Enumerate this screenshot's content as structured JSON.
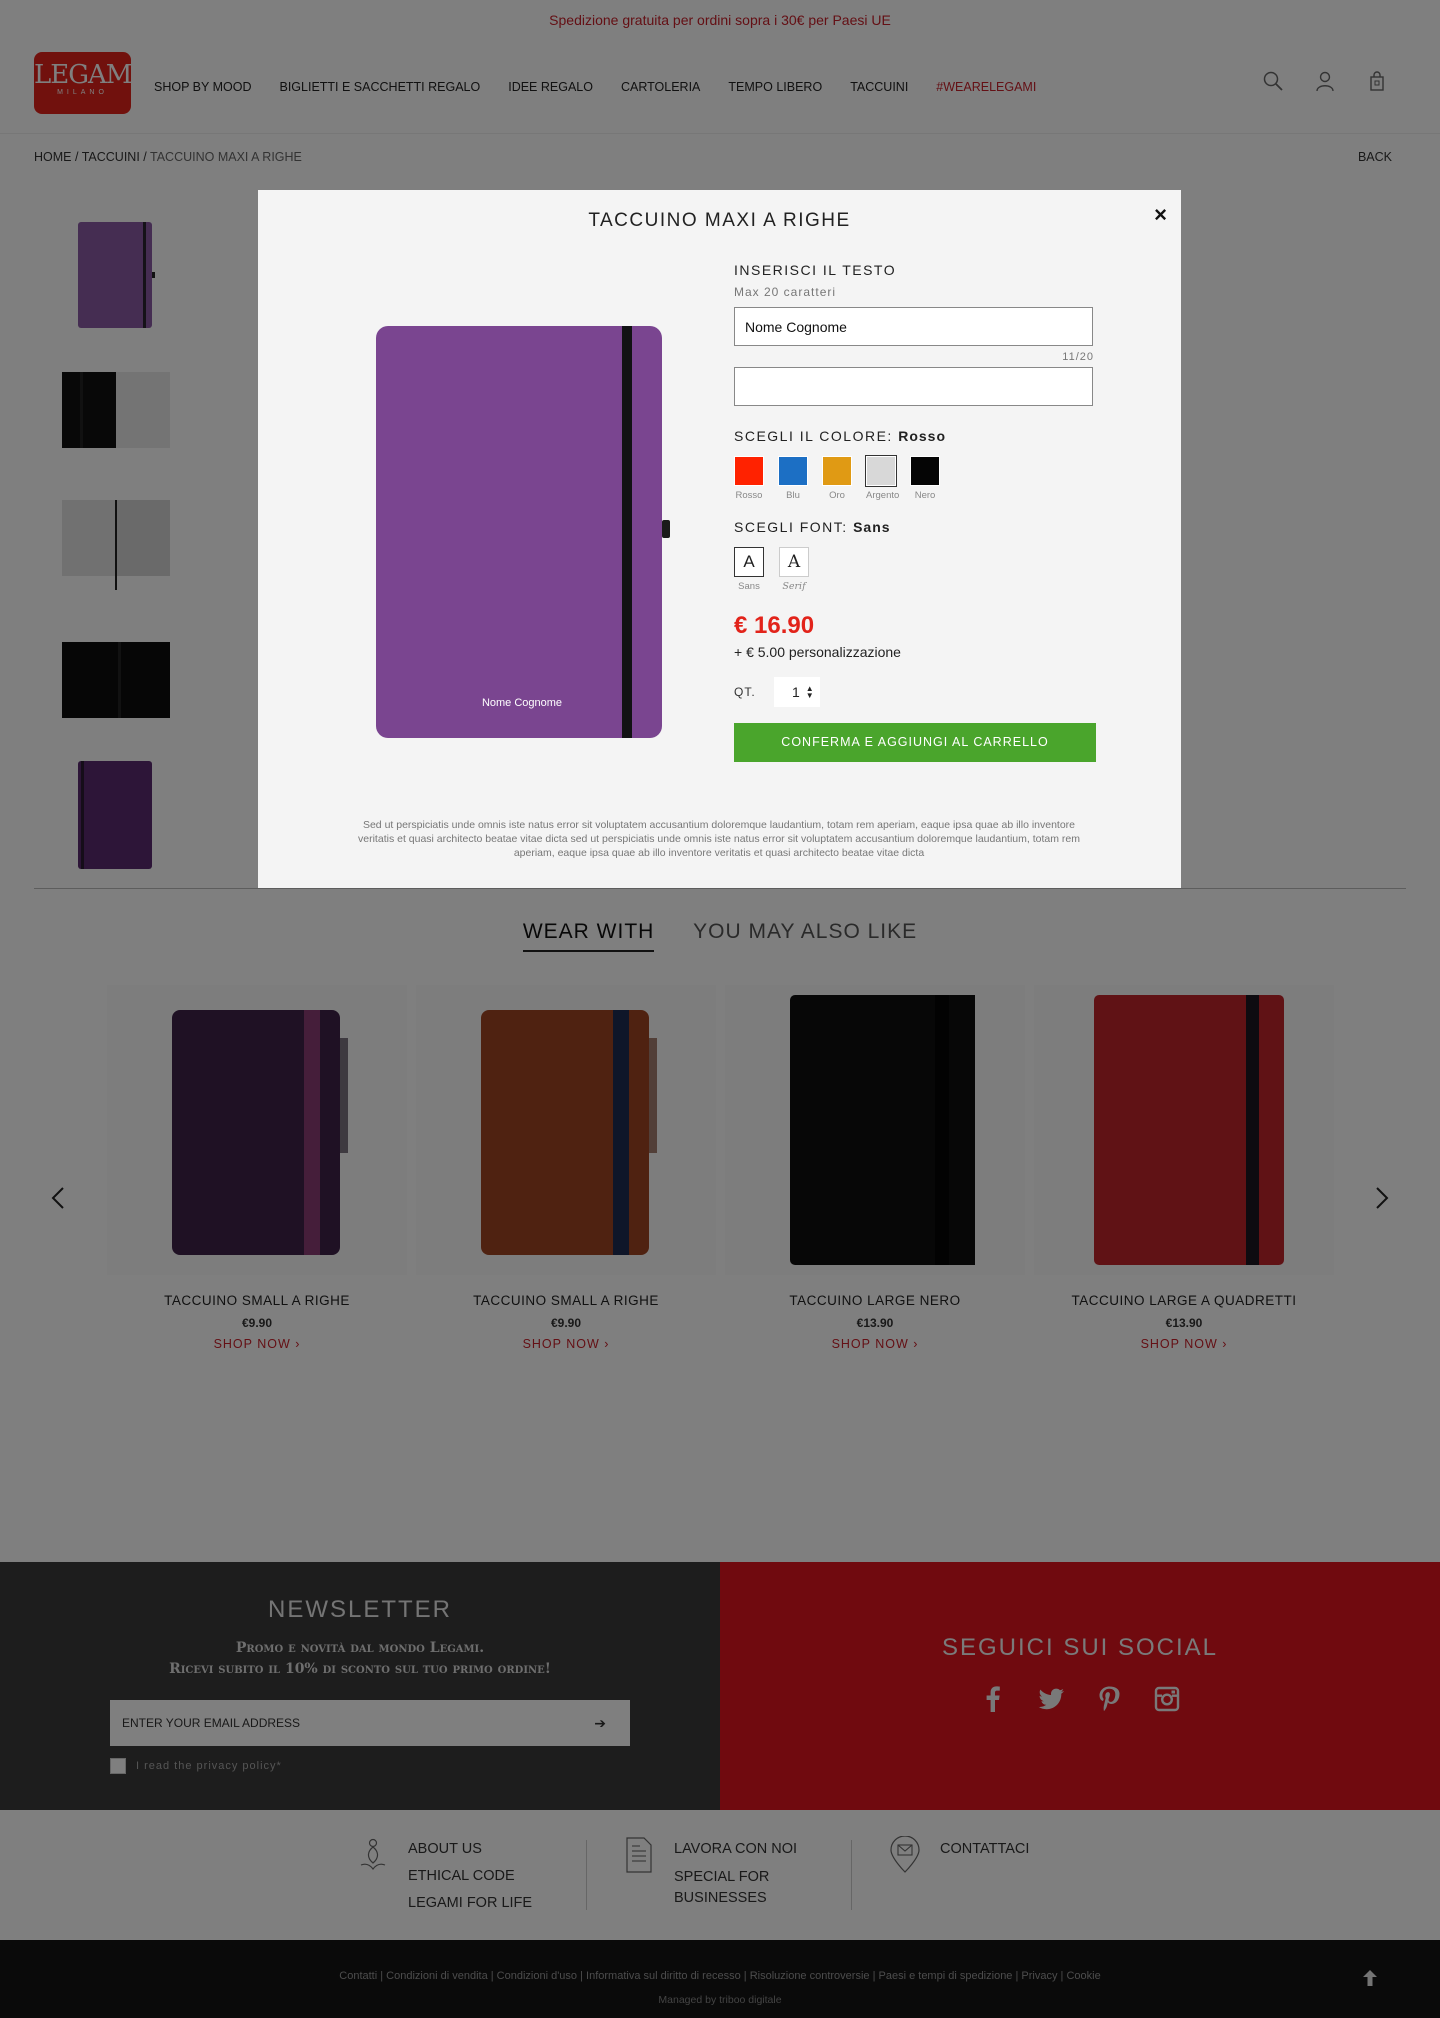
{
  "promo": "Spedizione gratuita per ordini sopra i 30€ per Paesi UE",
  "logo": {
    "name": "LEGAMI",
    "sub": "MILANO"
  },
  "nav": [
    "SHOP BY MOOD",
    "BIGLIETTI E SACCHETTI REGALO",
    "IDEE REGALO",
    "CARTOLERIA",
    "TEMPO LIBERO",
    "TACCUINI",
    "#WEARELEGAMI"
  ],
  "header_icons": [
    "search-icon",
    "user-icon",
    "cart-icon"
  ],
  "breadcrumb": {
    "home": "HOME",
    "sep": " / ",
    "cat": "TACCUINI",
    "current": "TACCUINO MAXI A RIGHE"
  },
  "back": "BACK",
  "tabs": [
    "WEAR WITH",
    "YOU MAY ALSO LIKE"
  ],
  "products": [
    {
      "name": "TACCUINO SMALL A RIGHE",
      "price": "€9.90",
      "shop": "SHOP NOW  ›",
      "color": "#3f2349",
      "band": "#8a3d74"
    },
    {
      "name": "TACCUINO SMALL A RIGHE",
      "price": "€9.90",
      "shop": "SHOP NOW  ›",
      "color": "#9e4522",
      "band": "#1e2d52"
    },
    {
      "name": "TACCUINO LARGE NERO",
      "price": "€13.90",
      "shop": "SHOP NOW  ›",
      "color": "#0e0e0e",
      "band": "#050505"
    },
    {
      "name": "TACCUINO LARGE A QUADRETTI",
      "price": "€13.90",
      "shop": "SHOP NOW  ›",
      "color": "#c0252b",
      "band": "#1d1620"
    }
  ],
  "newsletter": {
    "title": "NEWSLETTER",
    "line1": "Promo e novità dal mondo Legami.",
    "line2": "Ricevi subito il 10% di sconto sul tuo primo ordine!",
    "email_placeholder": "ENTER YOUR EMAIL ADDRESS",
    "submit": "➔",
    "privacy": "I read the privacy policy*"
  },
  "social": {
    "title": "SEGUICI SUI SOCIAL",
    "icons": [
      "facebook-icon",
      "twitter-icon",
      "pinterest-icon",
      "instagram-icon"
    ]
  },
  "footer_links": {
    "col1": [
      "ABOUT US",
      "ETHICAL CODE",
      "LEGAMI FOR LIFE"
    ],
    "col2": [
      "LAVORA CON NOI",
      "SPECIAL FOR",
      "BUSINESSES"
    ],
    "col3": [
      "CONTATTACI"
    ]
  },
  "bottom_links": [
    "Contatti",
    "Condizioni di vendita",
    "Condizioni d'uso",
    "Informativa sul diritto di recesso",
    "Risoluzione controversie",
    "Paesi e tempi di spedizione",
    "Privacy",
    "Cookie"
  ],
  "managed_by": "Managed by triboo digitale",
  "modal": {
    "title": "TACCUINO MAXI A RIGHE",
    "close": "×",
    "text_label": "INSERISCI IL TESTO",
    "max_hint": "Max 20 caratteri",
    "line1_value": "Nome Cognome",
    "counter": "11/20",
    "line2_value": "",
    "color_label": "SCEGLI IL COLORE:",
    "color_selected": "Rosso",
    "colors": [
      {
        "name": "Rosso",
        "hex": "#ff2200"
      },
      {
        "name": "Blu",
        "hex": "#1c6fc4"
      },
      {
        "name": "Oro",
        "hex": "#e09a14"
      },
      {
        "name": "Argento",
        "hex": "#d8d8d8"
      },
      {
        "name": "Nero",
        "hex": "#050505"
      }
    ],
    "font_label": "SCEGLI FONT:",
    "font_selected": "Sans",
    "fonts": [
      {
        "glyph": "A",
        "name": "Sans"
      },
      {
        "glyph": "A",
        "name": "Serif"
      }
    ],
    "price": "€ 16.90",
    "addon": "+ € 5.00 personalizzazione",
    "qty_label": "QT.",
    "qty": "1",
    "cta": "CONFERMA E AGGIUNGI AL CARRELLO",
    "notebook_text": "Nome Cognome",
    "notebook_color": "#7a4590",
    "description": "Sed ut perspiciatis unde omnis iste natus error sit voluptatem accusantium doloremque laudantium, totam rem aperiam, eaque ipsa quae ab illo inventore veritatis et quasi architecto beatae vitae dicta sed ut perspiciatis unde omnis iste natus error sit voluptatem accusantium doloremque laudantium, totam rem aperiam, eaque ipsa quae ab illo inventore veritatis et quasi architecto beatae vitae dicta"
  }
}
